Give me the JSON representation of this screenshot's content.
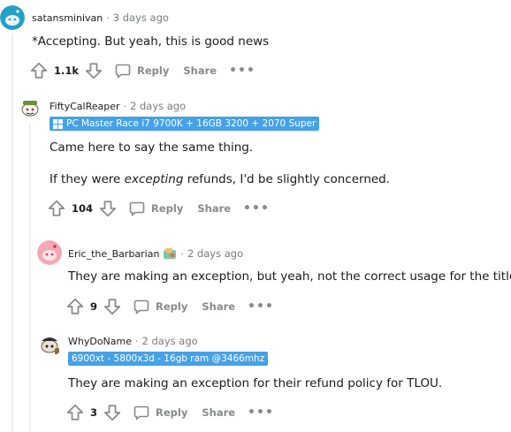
{
  "comments": [
    {
      "username": "satansminivan",
      "time": "3 days ago",
      "body": "*Accepting. But yeah, this is good news",
      "score": "1.1k"
    },
    {
      "username": "FiftyCalReaper",
      "time": "2 days ago",
      "flair": "PC Master Race i7 9700K + 16GB 3200 + 2070 Super",
      "body_line1": "Came here to say the same thing.",
      "body_line2_pre": "If they were ",
      "body_line2_em": "excepting",
      "body_line2_post": " refunds, I'd be slightly concerned.",
      "score": "104"
    },
    {
      "username": "Eric_the_Barbarian",
      "time": "2 days ago",
      "body": "They are making an exception, but yeah, not the correct usage for the title.",
      "score": "9"
    },
    {
      "username": "WhyDoName",
      "time": "2 days ago",
      "flair": "6900xt - 5800x3d - 16gb ram @3466mhz",
      "body": "They are making an exception for their refund policy for TLOU.",
      "score": "3"
    }
  ],
  "actions": {
    "reply_label": "Reply",
    "share_label": "Share",
    "more_label": "•••"
  },
  "separator": "·",
  "colors": {
    "flair_bg": "#46a1e6",
    "muted": "#878a8c",
    "thread_line": "#edeff1"
  }
}
